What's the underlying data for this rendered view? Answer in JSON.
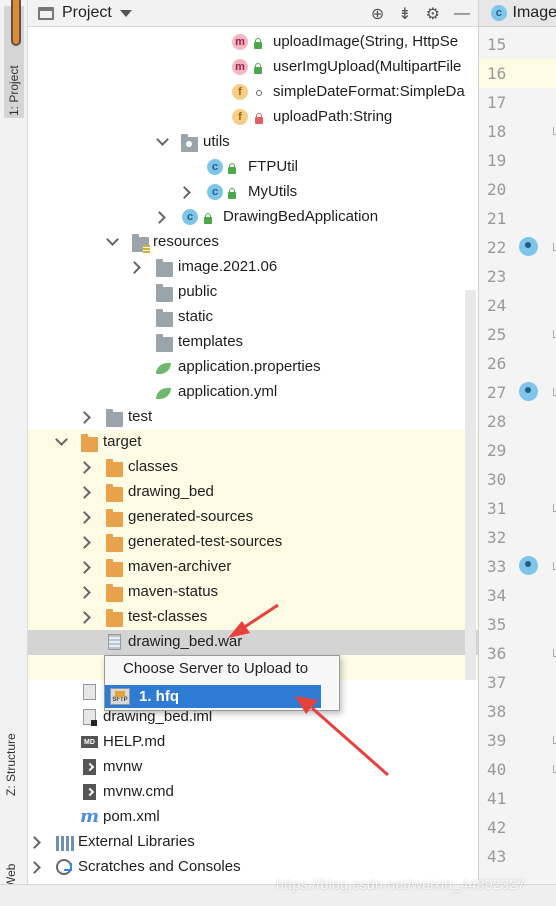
{
  "toolstrip": {
    "project_tab": "1: Project",
    "structure_tab": "Z: Structure",
    "web_tab": "Web"
  },
  "header": {
    "title": "Project",
    "icons": [
      "project-icon",
      "dropdown-caret-icon",
      "locate-icon",
      "collapse-all-icon",
      "gear-icon",
      "hide-icon"
    ]
  },
  "tree": {
    "rows": [
      {
        "label": "uploadImage(String, HttpSe",
        "icon": "method-icon"
      },
      {
        "label": "userImgUpload(MultipartFile",
        "icon": "method-icon"
      },
      {
        "label": "simpleDateFormat:SimpleDa",
        "icon": "field-icon"
      },
      {
        "label": "uploadPath:String",
        "icon": "field-icon"
      },
      {
        "label": "utils",
        "icon": "package-icon"
      },
      {
        "label": "FTPUtil",
        "icon": "class-icon"
      },
      {
        "label": "MyUtils",
        "icon": "class-icon"
      },
      {
        "label": "DrawingBedApplication",
        "icon": "spring-class-icon"
      },
      {
        "label": "resources",
        "icon": "resources-folder-icon"
      },
      {
        "label": "image.2021.06",
        "icon": "folder-icon"
      },
      {
        "label": "public",
        "icon": "folder-icon"
      },
      {
        "label": "static",
        "icon": "folder-icon"
      },
      {
        "label": "templates",
        "icon": "folder-icon"
      },
      {
        "label": "application.properties",
        "icon": "spring-config-icon"
      },
      {
        "label": "application.yml",
        "icon": "spring-config-icon"
      },
      {
        "label": "test",
        "icon": "folder-icon"
      },
      {
        "label": "target",
        "icon": "excluded-folder-icon"
      },
      {
        "label": "classes",
        "icon": "excluded-folder-icon"
      },
      {
        "label": "drawing_bed",
        "icon": "excluded-folder-icon"
      },
      {
        "label": "generated-sources",
        "icon": "excluded-folder-icon"
      },
      {
        "label": "generated-test-sources",
        "icon": "excluded-folder-icon"
      },
      {
        "label": "maven-archiver",
        "icon": "excluded-folder-icon"
      },
      {
        "label": "maven-status",
        "icon": "excluded-folder-icon"
      },
      {
        "label": "test-classes",
        "icon": "excluded-folder-icon"
      },
      {
        "label": "drawing_bed.war",
        "icon": "war-file-icon"
      },
      {
        "label": "drawing_bed.iml",
        "icon": "iml-file-icon"
      },
      {
        "label": "HELP.md",
        "icon": "markdown-file-icon"
      },
      {
        "label": "mvnw",
        "icon": "shell-script-icon"
      },
      {
        "label": "mvnw.cmd",
        "icon": "cmd-file-icon"
      },
      {
        "label": "pom.xml",
        "icon": "maven-icon"
      },
      {
        "label": "External Libraries",
        "icon": "libraries-icon"
      },
      {
        "label": "Scratches and Consoles",
        "icon": "scratches-icon"
      }
    ]
  },
  "popup": {
    "title": "Choose Server to Upload to",
    "items": [
      {
        "label": "1. hfq",
        "icon": "sftp-server-icon"
      }
    ]
  },
  "editor": {
    "tab_label": "Image",
    "line_numbers": [
      "15",
      "16",
      "17",
      "18",
      "19",
      "20",
      "21",
      "22",
      "23",
      "24",
      "25",
      "26",
      "27",
      "28",
      "29",
      "30",
      "31",
      "32",
      "33",
      "34",
      "35",
      "36",
      "37",
      "38",
      "39",
      "40",
      "41",
      "42",
      "43"
    ]
  },
  "watermark": "https://blog.csdn.net/weixin_44892327",
  "colors": {
    "selection": "#2e7bd3",
    "excluded_folder": "#e9a24c",
    "arrow": "#e8403a",
    "highlight_row": "#fdfbe3"
  }
}
